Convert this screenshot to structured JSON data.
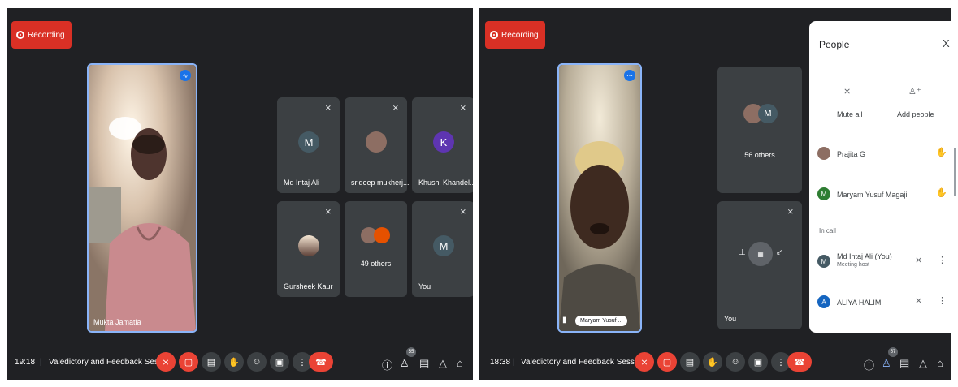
{
  "left": {
    "recording_label": "Recording",
    "main_speaker": "Mukta Jamatia",
    "tiles": [
      {
        "name": "Md Intaj Ali",
        "initial": "M",
        "color": "#455a64"
      },
      {
        "name": "srideep mukherj...",
        "initial": "",
        "color": "#8d6e63"
      },
      {
        "name": "Khushi Khandel...",
        "initial": "K",
        "color": "#5e35b1"
      },
      {
        "name": "Gursheek Kaur",
        "initial": "",
        "color": "#6d4c41"
      },
      {
        "name": "49 others",
        "initial": "",
        "color": "#8d6e63"
      },
      {
        "name": "You",
        "initial": "M",
        "color": "#455a64"
      }
    ],
    "time": "19:18",
    "separator": "|",
    "meeting_title": "Valedictory and Feedback Session",
    "people_count": "55"
  },
  "right": {
    "recording_label": "Recording",
    "main_speaker": "Maryam Yusuf ...",
    "others_label": "56 others",
    "others_initial": "M",
    "you_label": "You",
    "time": "18:38",
    "separator": "|",
    "meeting_title": "Valedictory and Feedback Session",
    "people_count": "57"
  },
  "people_panel": {
    "title": "People",
    "close_symbol": "X",
    "mute_all": "Mute all",
    "add_people": "Add people",
    "raised_hands": [
      {
        "name": "Prajita G",
        "initial": "",
        "color": "#8d6e63"
      },
      {
        "name": "Maryam Yusuf Magaji",
        "initial": "M",
        "color": "#2e7d32"
      }
    ],
    "in_call_label": "In call",
    "in_call": [
      {
        "name": "Md Intaj Ali (You)",
        "subtitle": "Meeting host",
        "initial": "M",
        "color": "#455a64"
      },
      {
        "name": "ALIYA HALIM",
        "subtitle": "",
        "initial": "A",
        "color": "#1565c0"
      }
    ]
  },
  "colors": {
    "recording": "#d93025",
    "background": "#202124",
    "tile": "#3c4043",
    "highlight": "#8ab4f8",
    "end_call": "#ea4335"
  },
  "icons": [
    "record-icon",
    "audio-wave-icon",
    "mic-off-icon",
    "hand-icon",
    "more-icon",
    "info-icon",
    "people-icon",
    "chat-icon",
    "activities-icon",
    "lock-icon",
    "emoji-icon",
    "caption-icon",
    "present-icon",
    "end-call-icon",
    "pin-icon",
    "mute-all-icon",
    "add-person-icon",
    "close-icon"
  ]
}
